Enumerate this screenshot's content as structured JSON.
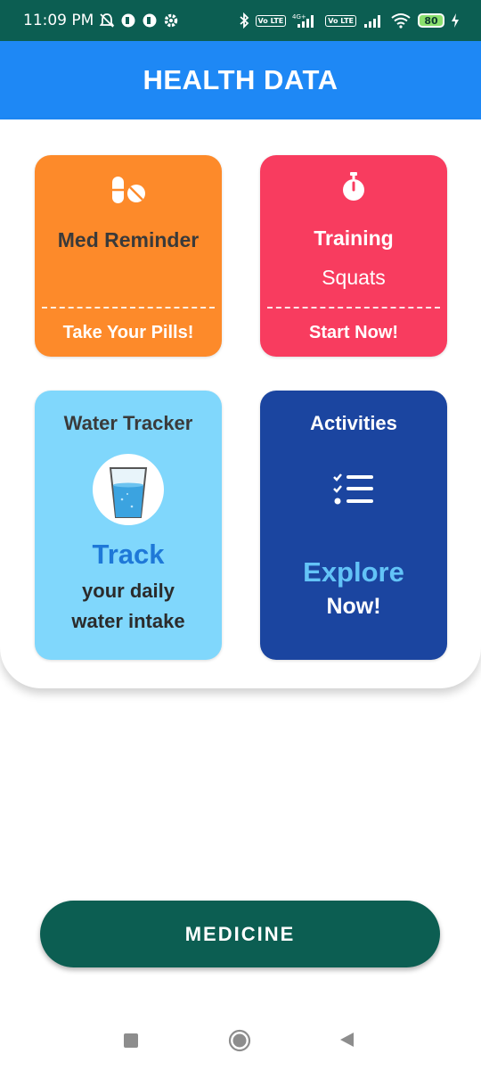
{
  "status_bar": {
    "time": "11:09 PM",
    "network_label": "4G+",
    "volte_label": "Vo LTE",
    "battery_level": "80"
  },
  "app_bar": {
    "title": "HEALTH DATA"
  },
  "cards": {
    "med_reminder": {
      "title": "Med Reminder",
      "action": "Take Your Pills!",
      "color": "#fd8a2a",
      "icon": "pills-icon"
    },
    "training": {
      "title": "Training",
      "subtitle": "Squats",
      "action": "Start Now!",
      "color": "#f83c5f",
      "icon": "stopwatch-icon"
    },
    "water_tracker": {
      "title": "Water Tracker",
      "headline": "Track",
      "line1": "your daily",
      "line2": "water intake",
      "color": "#80d7fc",
      "icon": "water-glass-icon"
    },
    "activities": {
      "title": "Activities",
      "headline": "Explore",
      "line2": "Now!",
      "color": "#1b45a0",
      "icon": "checklist-icon"
    }
  },
  "medicine_button": {
    "label": "MEDICINE",
    "color": "#0c5e52"
  },
  "nav_bar": {
    "buttons": [
      "recents",
      "home",
      "back"
    ]
  }
}
